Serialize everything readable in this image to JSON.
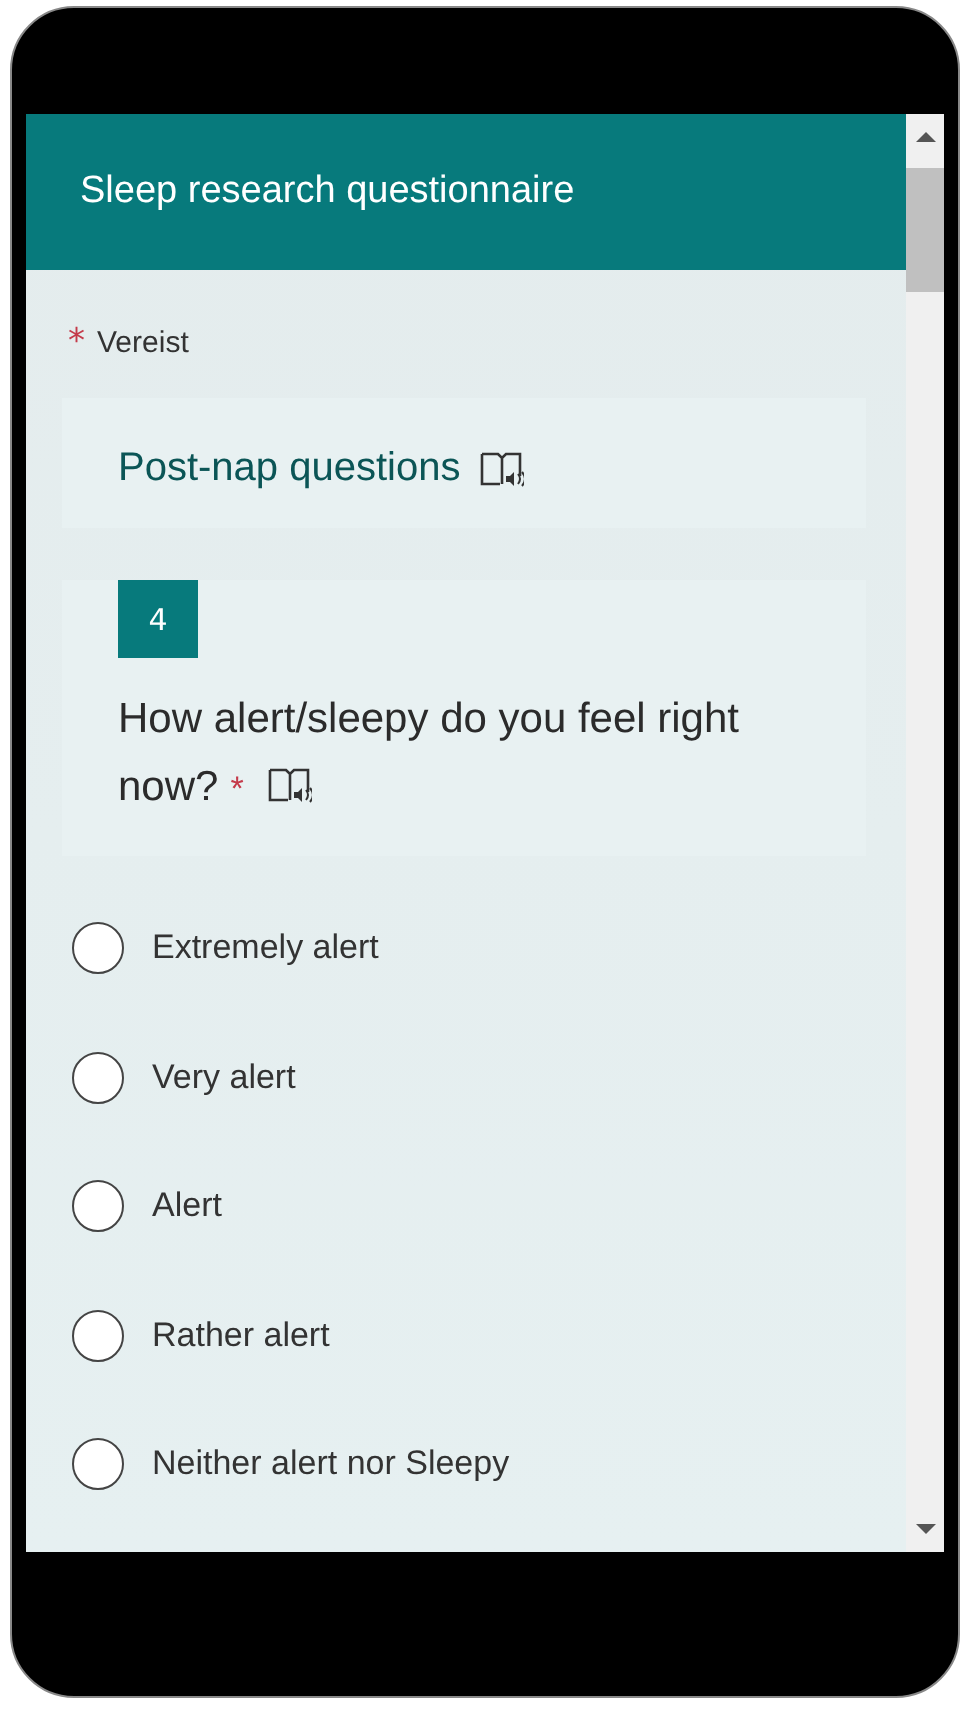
{
  "form": {
    "title": "Sleep research questionnaire",
    "required_mark": "*",
    "required_note": "Vereist"
  },
  "section": {
    "title": "Post-nap questions"
  },
  "question": {
    "number": "4",
    "text_lines": [
      "How alert/sleepy do you feel right",
      "now?"
    ],
    "required_mark": "*",
    "options": [
      {
        "label": "Extremely alert",
        "selected": false
      },
      {
        "label": "Very alert",
        "selected": false
      },
      {
        "label": "Alert",
        "selected": false
      },
      {
        "label": "Rather alert",
        "selected": false
      },
      {
        "label": "Neither alert nor Sleepy",
        "selected": false
      }
    ]
  }
}
